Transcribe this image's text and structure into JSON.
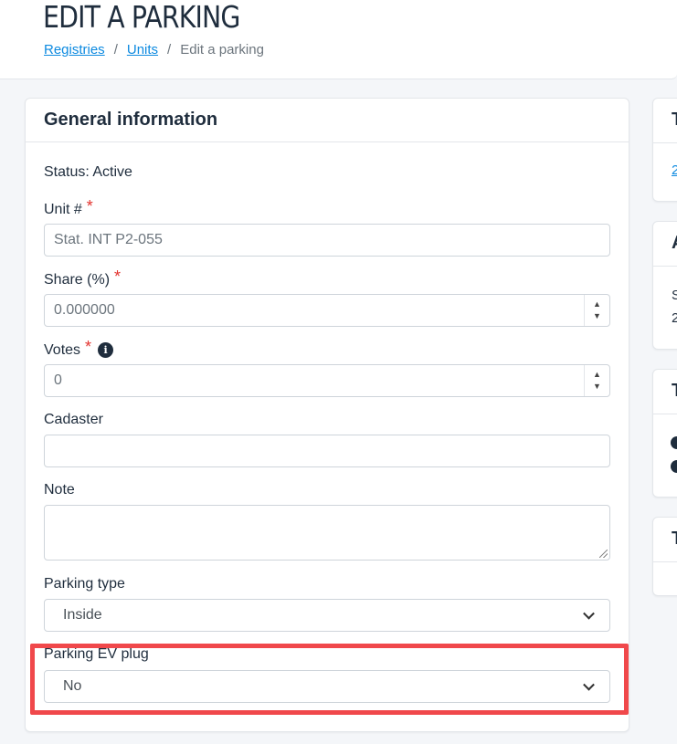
{
  "page": {
    "title": "EDIT A PARKING",
    "breadcrumb": {
      "item1": "Registries",
      "item2": "Units",
      "current": "Edit a parking",
      "separator": "/"
    }
  },
  "general_card": {
    "title": "General information",
    "status": "Status: Active",
    "unit_label": "Unit #",
    "unit_value": "Stat. INT P2-055",
    "share_label": "Share (%)",
    "share_value": "0.000000",
    "votes_label": "Votes",
    "votes_value": "0",
    "cadaster_label": "Cadaster",
    "cadaster_value": "",
    "note_label": "Note",
    "note_value": "",
    "parking_type_label": "Parking type",
    "parking_type_value": "Inside",
    "ev_plug_label": "Parking EV plug",
    "ev_plug_value": "No",
    "required_mark": "*",
    "info_icon_glyph": "i"
  },
  "side_cards": {
    "card1_letter": "T",
    "card1_link": "2",
    "card2_letter": "A",
    "card2_text1": "S",
    "card2_text2": "2",
    "card3_letter": "T",
    "card4_letter": "T"
  },
  "colors": {
    "accent_link": "#0d8ae0",
    "required": "#e3342f",
    "highlight": "#f0484b"
  }
}
